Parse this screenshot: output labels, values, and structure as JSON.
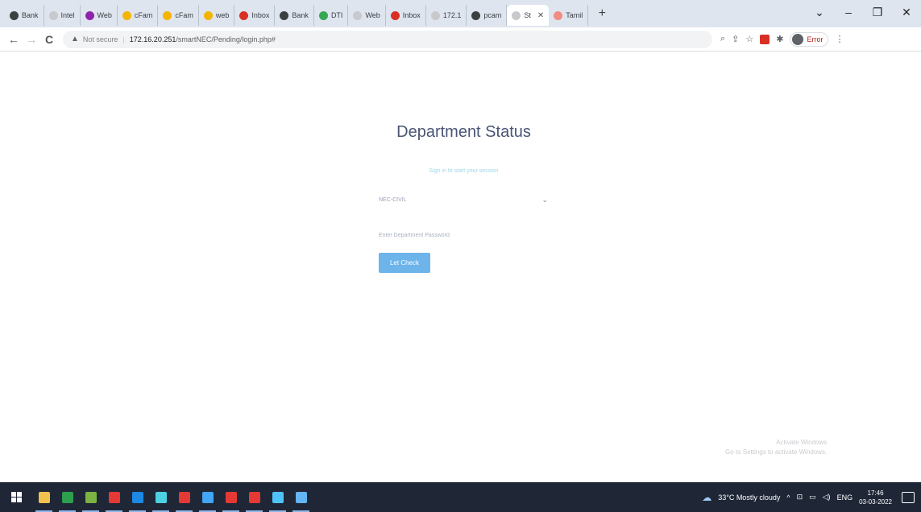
{
  "browser": {
    "tabs": [
      {
        "label": "Bank",
        "color": "#3c4043"
      },
      {
        "label": "Intel",
        "color": "#c7c9cc"
      },
      {
        "label": "Web",
        "color": "#8e24aa"
      },
      {
        "label": "cFam",
        "color": "#f4b400"
      },
      {
        "label": "cFam",
        "color": "#f4b400"
      },
      {
        "label": "web",
        "color": "#f4b400"
      },
      {
        "label": "Inbox",
        "color": "#d93025"
      },
      {
        "label": "Bank",
        "color": "#3c4043"
      },
      {
        "label": "DTI",
        "color": "#34a853"
      },
      {
        "label": "Web",
        "color": "#c7c9cc"
      },
      {
        "label": "Inbox",
        "color": "#d93025"
      },
      {
        "label": "172.1",
        "color": "#c7c9cc"
      },
      {
        "label": "pcam",
        "color": "#3c4043"
      },
      {
        "label": "St",
        "color": "#c7c9cc",
        "active": true
      },
      {
        "label": "Tamil",
        "color": "#f28b82"
      }
    ],
    "new_tab": "+",
    "window_controls": {
      "dropdown": "⌄",
      "minimize": "–",
      "maximize": "❐",
      "close": "✕"
    },
    "nav": {
      "back": "←",
      "forward": "→",
      "reload": "C"
    },
    "address": {
      "security_label": "Not secure",
      "host": "172.16.20.251",
      "path": "/smartNEC/Pending/login.php#"
    },
    "profile_label": "Error"
  },
  "page": {
    "title": "Department Status",
    "subtitle": "Sign in to start your session",
    "department_select": {
      "selected": "NEC-CIVIL"
    },
    "password_field": {
      "placeholder": "Enter Department Password"
    },
    "submit_label": "Let Check",
    "watermark": [
      "Activate Windows",
      "Go to Settings to activate Windows."
    ]
  },
  "taskbar": {
    "apps": [
      {
        "name": "file-explorer-icon",
        "color": "#f2c14e",
        "running": true
      },
      {
        "name": "excel-icon",
        "color": "#2e9e4f",
        "running": true
      },
      {
        "name": "notepad-icon",
        "color": "#7cb342",
        "running": true
      },
      {
        "name": "paint-icon",
        "color": "#e53935",
        "running": true
      },
      {
        "name": "chrome-icon",
        "color": "#1e88e5",
        "running": true
      },
      {
        "name": "edge-icon",
        "color": "#4dd0e1",
        "running": true
      },
      {
        "name": "pdf-icon",
        "color": "#e53935",
        "running": true
      },
      {
        "name": "search-app-icon",
        "color": "#42a5f5",
        "running": true
      },
      {
        "name": "pdf-icon-2",
        "color": "#e53935",
        "running": true
      },
      {
        "name": "pdf-icon-3",
        "color": "#e53935",
        "running": true
      },
      {
        "name": "chrome-icon-2",
        "color": "#4fc3f7",
        "running": true
      },
      {
        "name": "document-icon",
        "color": "#64b5f6",
        "running": true
      }
    ],
    "weather": "33°C  Mostly cloudy",
    "language": "ENG",
    "time": "17:46",
    "date": "03-03-2022"
  }
}
